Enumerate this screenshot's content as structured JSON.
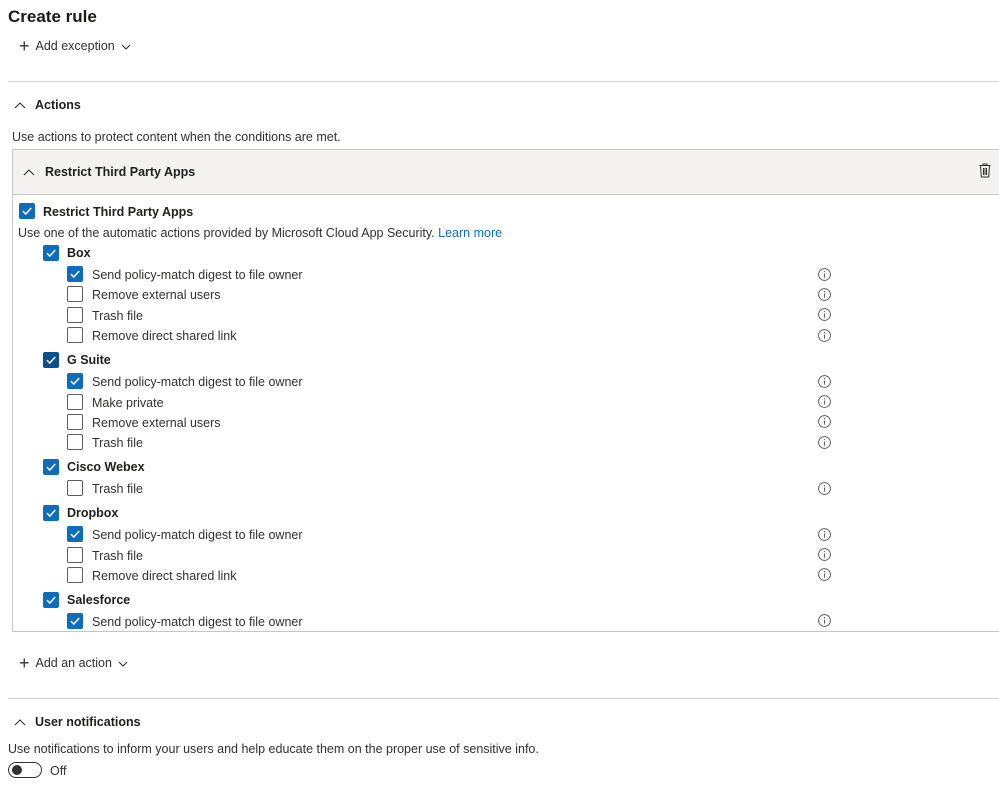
{
  "page": {
    "title": "Create rule"
  },
  "add_exception": {
    "label": "Add exception"
  },
  "actions_section": {
    "title": "Actions",
    "description": "Use actions to protect content when the conditions are met."
  },
  "panel": {
    "title": "Restrict Third Party Apps",
    "main_checkbox_label": "Restrict Third Party Apps",
    "main_checked": true,
    "description": "Use one of the automatic actions provided by Microsoft Cloud App Security.",
    "learn_more": "Learn more",
    "apps": [
      {
        "name": "Box",
        "checked": true,
        "options": [
          {
            "label": "Send policy-match digest to file owner",
            "checked": true
          },
          {
            "label": "Remove external users",
            "checked": false
          },
          {
            "label": "Trash file",
            "checked": false
          },
          {
            "label": "Remove direct shared link",
            "checked": false
          }
        ]
      },
      {
        "name": "G Suite",
        "checked": true,
        "options": [
          {
            "label": "Send policy-match digest to file owner",
            "checked": true
          },
          {
            "label": "Make private",
            "checked": false
          },
          {
            "label": "Remove external users",
            "checked": false
          },
          {
            "label": "Trash file",
            "checked": false
          }
        ]
      },
      {
        "name": "Cisco Webex",
        "checked": true,
        "options": [
          {
            "label": "Trash file",
            "checked": false
          }
        ]
      },
      {
        "name": "Dropbox",
        "checked": true,
        "options": [
          {
            "label": "Send policy-match digest to file owner",
            "checked": true
          },
          {
            "label": "Trash file",
            "checked": false
          },
          {
            "label": "Remove direct shared link",
            "checked": false
          }
        ]
      },
      {
        "name": "Salesforce",
        "checked": true,
        "options": [
          {
            "label": "Send policy-match digest to file owner",
            "checked": true
          }
        ]
      }
    ]
  },
  "add_action": {
    "label": "Add an action"
  },
  "notifications_section": {
    "title": "User notifications",
    "description": "Use notifications to inform your users and help educate them on the proper use of sensitive info.",
    "toggle_state": "Off"
  },
  "colors": {
    "accent": "#0f6cbd",
    "panel_header_bg": "#f3f2f1",
    "border": "#c8c6c4"
  },
  "icons": {
    "add": "plus-icon",
    "expand": "chevron-down-icon",
    "collapse": "chevron-up-icon",
    "delete": "trash-icon",
    "info": "info-icon"
  }
}
